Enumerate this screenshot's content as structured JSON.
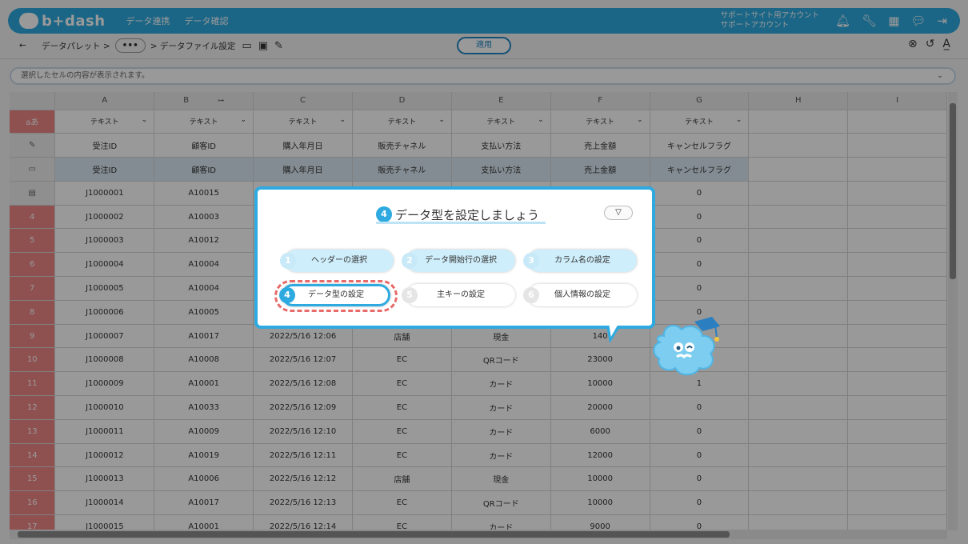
{
  "app": {
    "logo_text": "b+dash",
    "nav": [
      "データ連携",
      "データ確認"
    ],
    "account_line1": "サポートサイト用アカウント",
    "account_line2": "サポートアカウント",
    "brand_color": "#2eaae0",
    "icons": [
      "bell-icon",
      "wrench-icon",
      "grid-icon",
      "chat-icon",
      "logout-icon"
    ]
  },
  "toolbar": {
    "back_label": "←",
    "crumb1": "データパレット >",
    "ellipsis": "•••",
    "crumb2": "> データファイル設定",
    "apply_label": "適用"
  },
  "cellbar": {
    "placeholder": "選択したセルの内容が表示されます。"
  },
  "grid": {
    "corner_label": "aあ",
    "columns": [
      "A",
      "B",
      "C",
      "D",
      "E",
      "F",
      "G",
      "H",
      "I"
    ],
    "type_label": "テキスト",
    "headers1": [
      "受注ID",
      "顧客ID",
      "購入年月日",
      "販売チャネル",
      "支払い方法",
      "売上金額",
      "キャンセルフラグ"
    ],
    "headers2": [
      "受注ID",
      "顧客ID",
      "購入年月日",
      "販売チャネル",
      "支払い方法",
      "売上金額",
      "キャンセルフラグ"
    ],
    "rows": [
      {
        "num": "",
        "cells": [
          "J1000001",
          "A10015",
          "",
          "",
          "",
          "",
          "0"
        ]
      },
      {
        "num": "4",
        "cells": [
          "J1000002",
          "A10003",
          "",
          "",
          "",
          "",
          "0"
        ]
      },
      {
        "num": "5",
        "cells": [
          "J1000003",
          "A10012",
          "",
          "",
          "",
          "",
          "0"
        ]
      },
      {
        "num": "6",
        "cells": [
          "J1000004",
          "A10004",
          "",
          "",
          "",
          "",
          "0"
        ]
      },
      {
        "num": "7",
        "cells": [
          "J1000005",
          "A10004",
          "",
          "",
          "",
          "",
          "0"
        ]
      },
      {
        "num": "8",
        "cells": [
          "J1000006",
          "A10005",
          "",
          "",
          "",
          "",
          "0"
        ]
      },
      {
        "num": "9",
        "cells": [
          "J1000007",
          "A10017",
          "2022/5/16 12:06",
          "店舗",
          "現金",
          "140",
          ""
        ]
      },
      {
        "num": "10",
        "cells": [
          "J1000008",
          "A10008",
          "2022/5/16 12:07",
          "EC",
          "QRコード",
          "23000",
          "0"
        ]
      },
      {
        "num": "11",
        "cells": [
          "J1000009",
          "A10001",
          "2022/5/16 12:08",
          "EC",
          "カード",
          "10000",
          "1"
        ]
      },
      {
        "num": "12",
        "cells": [
          "J1000010",
          "A10033",
          "2022/5/16 12:09",
          "EC",
          "カード",
          "20000",
          "0"
        ]
      },
      {
        "num": "13",
        "cells": [
          "J1000011",
          "A10009",
          "2022/5/16 12:10",
          "EC",
          "カード",
          "6000",
          "0"
        ]
      },
      {
        "num": "14",
        "cells": [
          "J1000012",
          "A10019",
          "2022/5/16 12:11",
          "EC",
          "カード",
          "12000",
          "0"
        ]
      },
      {
        "num": "15",
        "cells": [
          "J1000013",
          "A10006",
          "2022/5/16 12:12",
          "店舗",
          "現金",
          "10000",
          "0"
        ]
      },
      {
        "num": "16",
        "cells": [
          "J1000014",
          "A10017",
          "2022/5/16 12:13",
          "EC",
          "QRコード",
          "10000",
          "0"
        ]
      },
      {
        "num": "17",
        "cells": [
          "J1000015",
          "A10001",
          "2022/5/16 12:14",
          "EC",
          "カード",
          "9000",
          "0"
        ]
      }
    ]
  },
  "dialog": {
    "step_number": "4",
    "title": "データ型を設定しましょう",
    "toggle_icon": "beginner-mark-icon",
    "steps": [
      {
        "n": "1",
        "label": "ヘッダーの選択",
        "state": "done"
      },
      {
        "n": "2",
        "label": "データ開始行の選択",
        "state": "done"
      },
      {
        "n": "3",
        "label": "カラム名の設定",
        "state": "done"
      },
      {
        "n": "4",
        "label": "データ型の設定",
        "state": "current"
      },
      {
        "n": "5",
        "label": "主キーの設定",
        "state": "pending"
      },
      {
        "n": "6",
        "label": "個人情報の設定",
        "state": "pending"
      }
    ]
  }
}
